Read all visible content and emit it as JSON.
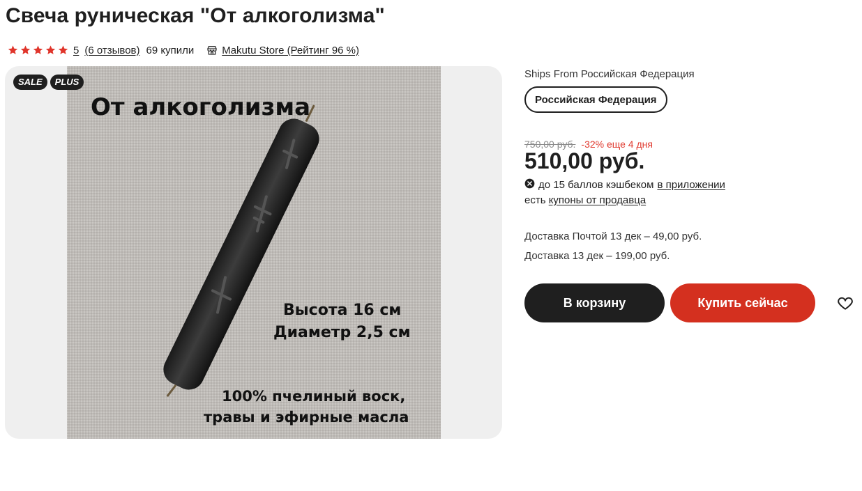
{
  "product": {
    "title": "Свеча руническая \"От алкоголизма\"",
    "rating": "5",
    "reviews": "(6 отзывов)",
    "bought": "69 купили",
    "store": "Makutu Store (Рейтинг 96 %)",
    "star_count": 5,
    "icons": {
      "star": "star-icon",
      "store": "store-icon",
      "cashback": "close-circle-icon",
      "wishlist": "heart-icon"
    }
  },
  "gallery": {
    "badges": [
      "SALE",
      "PLUS"
    ],
    "image_text": {
      "headline": "От алкоголизма",
      "height": "Высота 16 см",
      "diameter": "Диаметр 2,5 см",
      "material_1": "100% пчелиный воск,",
      "material_2": "травы и эфирные масла"
    }
  },
  "shipping": {
    "ships_from": "Ships From Российская Федерация",
    "chip": "Российская Федерация"
  },
  "pricing": {
    "old_price": "750,00 руб.",
    "discount": "-32% еще 4 дня",
    "price": "510,00 руб.",
    "cashback_text": "до 15 баллов кэшбеком",
    "cashback_link": "в приложении",
    "coupon_text": "есть",
    "coupon_link": "купоны от продавца"
  },
  "delivery": {
    "post": "Доставка Почтой 13 дек – 49,00 руб.",
    "standard": "Доставка 13 дек – 199,00 руб."
  },
  "actions": {
    "cart": "В корзину",
    "buy": "Купить сейчас"
  },
  "colors": {
    "accent_red": "#d4301f",
    "dark": "#1f1f1f",
    "discount_red": "#e03a2f",
    "star_red": "#e0352b"
  }
}
